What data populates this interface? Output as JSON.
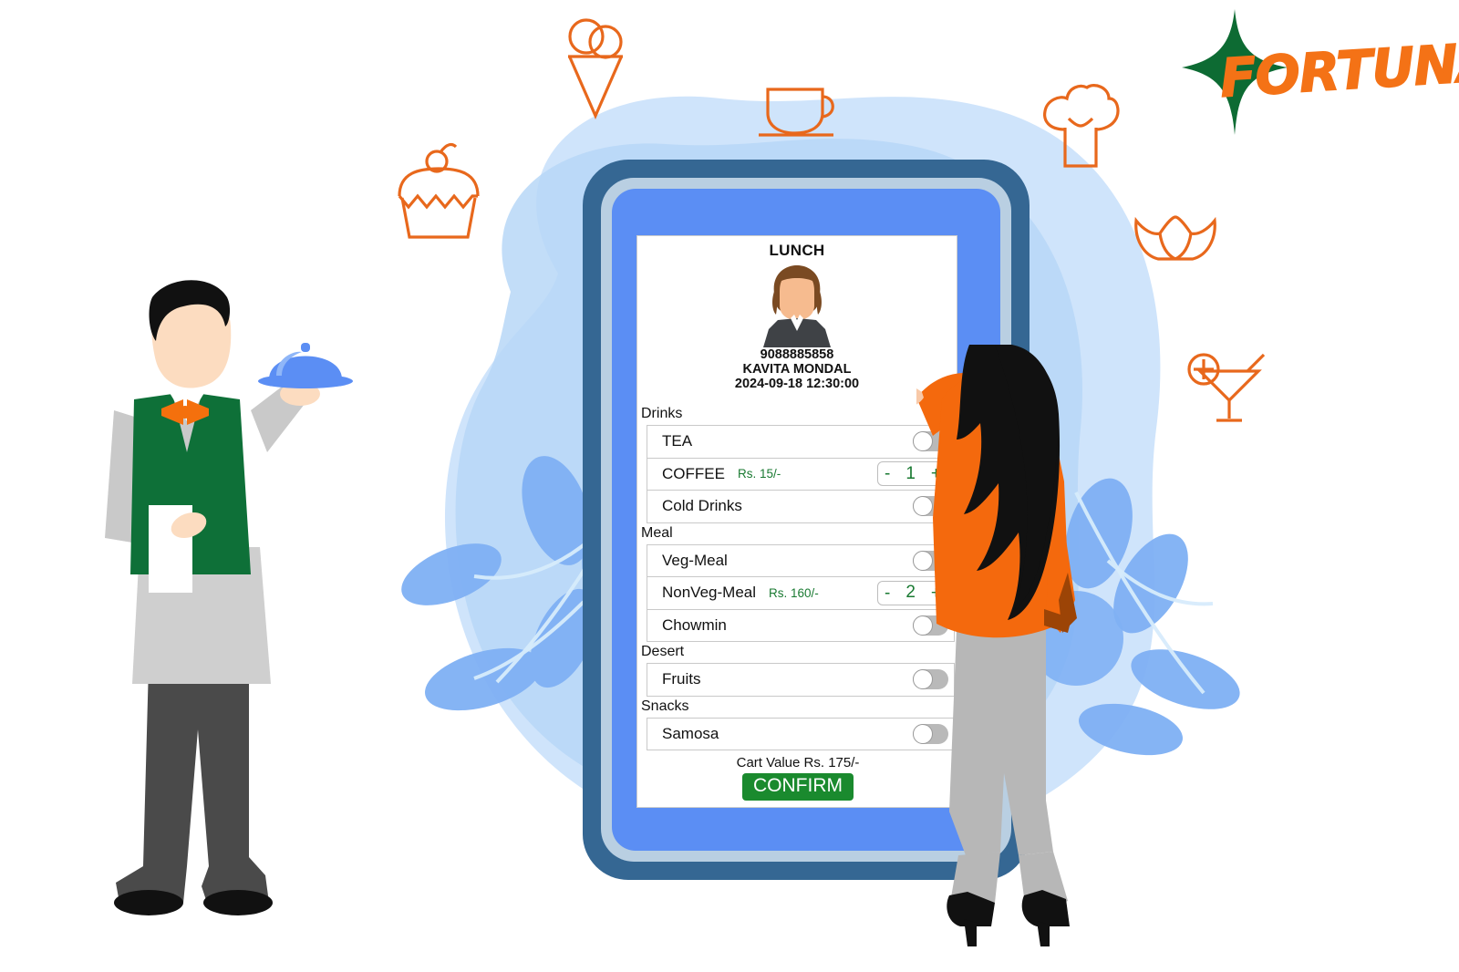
{
  "brand": {
    "logo_text": "FORTUNA",
    "logo_star_color": "#0d6b33",
    "logo_text_color": "#F47216"
  },
  "decor": {
    "icon_color": "#e8681c",
    "blob_color": "#b7d7f7",
    "icons": [
      {
        "name": "ice-cream-cone-icon"
      },
      {
        "name": "cupcake-icon"
      },
      {
        "name": "coffee-cup-icon"
      },
      {
        "name": "chef-hat-icon"
      },
      {
        "name": "croissant-icon"
      },
      {
        "name": "cocktail-glass-icon"
      }
    ]
  },
  "device": {
    "frame_outer_color": "#356793",
    "frame_mid_color": "#b9cfe2",
    "frame_inner_color": "#5b8ef4"
  },
  "screen": {
    "title": "LUNCH",
    "phone": "9088885858",
    "customer_name": "KAVITA MONDAL",
    "timestamp": "2024-09-18 12:30:00"
  },
  "menu": {
    "sections": [
      {
        "label": "Drinks",
        "items": [
          {
            "name": "TEA",
            "price": "",
            "control": "toggle",
            "selected": false,
            "qty": null
          },
          {
            "name": "COFFEE",
            "price": "Rs. 15/-",
            "control": "stepper",
            "selected": true,
            "qty": "1"
          },
          {
            "name": "Cold Drinks",
            "price": "",
            "control": "toggle",
            "selected": false,
            "qty": null
          }
        ]
      },
      {
        "label": "Meal",
        "items": [
          {
            "name": "Veg-Meal",
            "price": "",
            "control": "toggle",
            "selected": false,
            "qty": null
          },
          {
            "name": "NonVeg-Meal",
            "price": "Rs. 160/-",
            "control": "stepper",
            "selected": true,
            "qty": "2"
          },
          {
            "name": "Chowmin",
            "price": "",
            "control": "toggle",
            "selected": false,
            "qty": null
          }
        ]
      },
      {
        "label": "Desert",
        "items": [
          {
            "name": "Fruits",
            "price": "",
            "control": "toggle",
            "selected": false,
            "qty": null
          }
        ]
      },
      {
        "label": "Snacks",
        "items": [
          {
            "name": "Samosa",
            "price": "",
            "control": "toggle",
            "selected": false,
            "qty": null
          }
        ]
      }
    ],
    "stepper_minus": "-",
    "stepper_plus": "+",
    "cart_value_text": "Cart Value Rs. 175/-",
    "confirm_label": "CONFIRM",
    "accent_green": "#1a7a32",
    "confirm_bg": "#1a8a2e"
  },
  "people": [
    {
      "name": "waiter-illustration"
    },
    {
      "name": "customer-woman-illustration"
    }
  ]
}
